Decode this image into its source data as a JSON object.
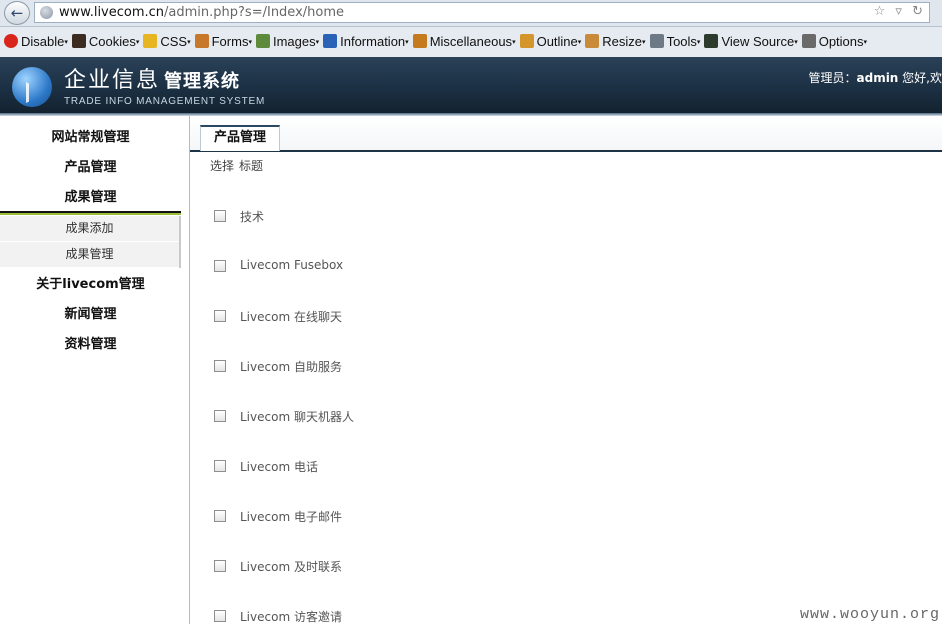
{
  "browser": {
    "url_domain": "www.livecom.cn",
    "url_path": "/admin.php?s=/Index/home"
  },
  "devtoolbar": {
    "items": [
      {
        "label": "Disable",
        "icon": "disable-icon",
        "color": "#d9261c"
      },
      {
        "label": "Cookies",
        "icon": "cookies-icon",
        "color": "#3b2b20"
      },
      {
        "label": "CSS",
        "icon": "css-icon",
        "color": "#e8b522"
      },
      {
        "label": "Forms",
        "icon": "forms-icon",
        "color": "#c8782a"
      },
      {
        "label": "Images",
        "icon": "images-icon",
        "color": "#5d8a3b"
      },
      {
        "label": "Information",
        "icon": "information-icon",
        "color": "#2a62b8"
      },
      {
        "label": "Miscellaneous",
        "icon": "miscellaneous-icon",
        "color": "#c57a1d"
      },
      {
        "label": "Outline",
        "icon": "outline-icon",
        "color": "#d4952b"
      },
      {
        "label": "Resize",
        "icon": "resize-icon",
        "color": "#c98a3a"
      },
      {
        "label": "Tools",
        "icon": "tools-icon",
        "color": "#6d7a86"
      },
      {
        "label": "View Source",
        "icon": "view-source-icon",
        "color": "#2c3b2c"
      },
      {
        "label": "Options",
        "icon": "options-icon",
        "color": "#6a6a6a"
      }
    ]
  },
  "header": {
    "title": "企业信息",
    "subtitle": "管理系统",
    "english": "TRADE INFO MANAGEMENT SYSTEM",
    "admin_label": "管理员：",
    "admin_name": "admin",
    "admin_suffix": " 您好,欢"
  },
  "sidebar": {
    "menus": [
      "网站常规管理",
      "产品管理",
      "成果管理"
    ],
    "submenu": [
      "成果添加",
      "成果管理"
    ],
    "menus_after": [
      "关于livecom管理",
      "新闻管理",
      "资料管理"
    ]
  },
  "main": {
    "tab": "产品管理",
    "col_select": "选择",
    "col_title": "标题",
    "rows": [
      "技术",
      "Livecom Fusebox",
      "Livecom 在线聊天",
      "Livecom 自助服务",
      "Livecom 聊天机器人",
      "Livecom 电话",
      "Livecom 电子邮件",
      "Livecom 及时联系",
      "Livecom 访客邀请"
    ]
  },
  "watermark": "www.wooyun.org"
}
